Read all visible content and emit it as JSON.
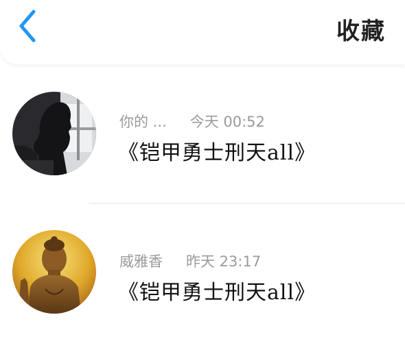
{
  "header": {
    "back_icon": "chevron-left-icon",
    "title": "收藏",
    "accent_color": "#2196F3"
  },
  "favorites": [
    {
      "user": "你的 ...",
      "time": "今天 00:52",
      "song": "《铠甲勇士刑天all》",
      "avatar": "silhouette-by-window"
    },
    {
      "user": "威雅香",
      "time": "昨天 23:17",
      "song": "《铠甲勇士刑天all》",
      "avatar": "golden-buddha-statue"
    }
  ]
}
